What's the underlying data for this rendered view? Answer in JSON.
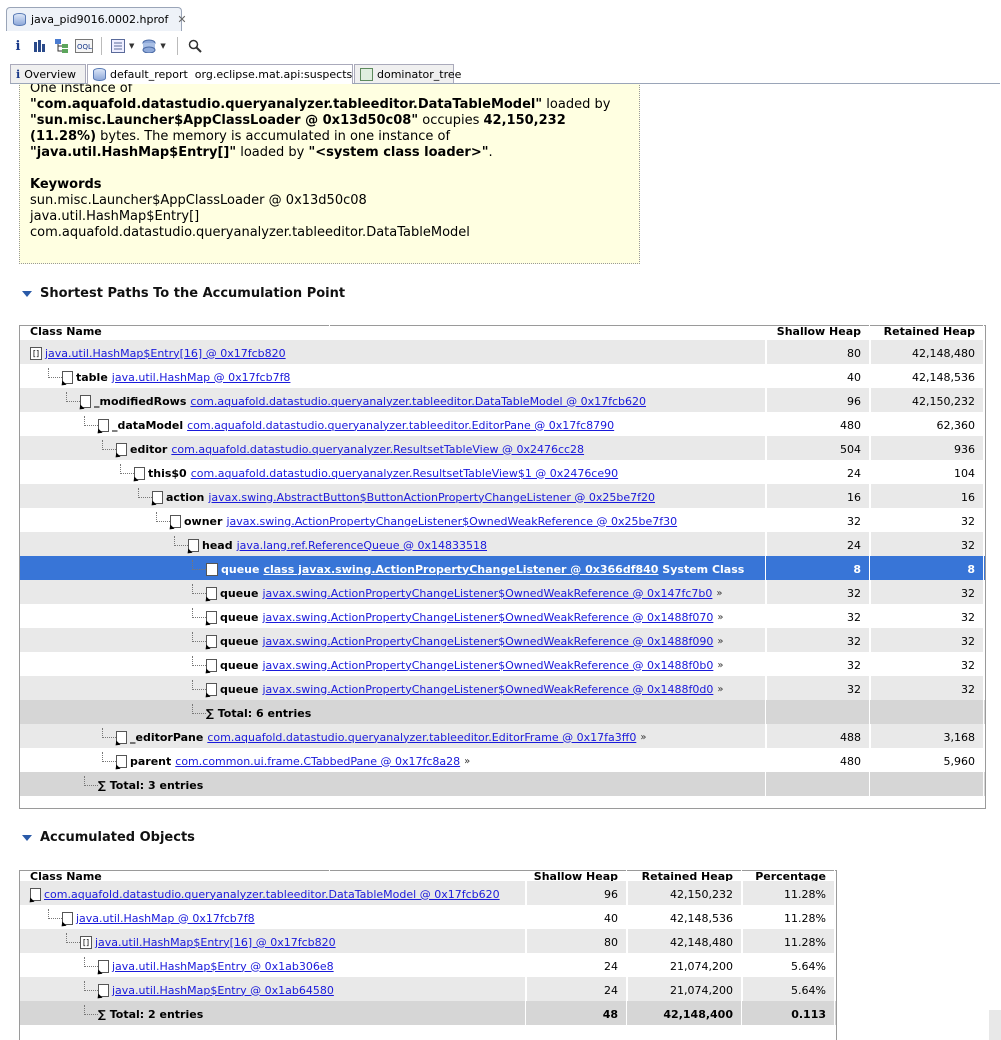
{
  "window": {
    "file_tab": "java_pid9016.0002.hprof",
    "toolbar_icons": [
      "info-icon",
      "histogram-icon",
      "dominator-tree-icon",
      "oql-icon",
      "query-browser-icon",
      "heap-dump-overview-icon",
      "search-icon"
    ]
  },
  "editor_tabs": [
    {
      "label": "Overview"
    },
    {
      "label": "default_report  org.eclipse.mat.api:suspects"
    },
    {
      "label": "dominator_tree"
    }
  ],
  "description": {
    "line1": "One instance of",
    "class_name": "\"com.aquafold.datastudio.queryanalyzer.tableeditor.DataTableModel\"",
    "loaded_by_1": " loaded by",
    "loader": "\"sun.misc.Launcher$AppClassLoader @ 0x13d50c08\"",
    "occupies": " occupies ",
    "bytes_value": "42,150,232",
    "percent": "(11.28%)",
    "accum_text": " bytes. The memory is accumulated in one instance of",
    "accum_class": "\"java.util.HashMap$Entry[]\"",
    "loaded_by_2": " loaded by ",
    "system_loader": "\"<system class loader>\"",
    "period": ".",
    "keywords_title": "Keywords",
    "keywords": [
      "sun.misc.Launcher$AppClassLoader @ 0x13d50c08",
      "java.util.HashMap$Entry[]",
      "com.aquafold.datastudio.queryanalyzer.tableeditor.DataTableModel"
    ]
  },
  "paths_section": {
    "title": "Shortest Paths To the Accumulation Point",
    "headers": {
      "class_name": "Class Name",
      "shallow": "Shallow Heap",
      "retained": "Retained Heap"
    },
    "rows": [
      {
        "field": "",
        "link": "java.util.HashMap$Entry[16] @ 0x17fcb820",
        "suffix": "",
        "shallow": "80",
        "retained": "42,148,480"
      },
      {
        "field": "table",
        "link": "java.util.HashMap @ 0x17fcb7f8",
        "suffix": "",
        "shallow": "40",
        "retained": "42,148,536"
      },
      {
        "field": "_modifiedRows",
        "link": "com.aquafold.datastudio.queryanalyzer.tableeditor.DataTableModel @ 0x17fcb620",
        "suffix": "",
        "shallow": "96",
        "retained": "42,150,232"
      },
      {
        "field": "_dataModel",
        "link": "com.aquafold.datastudio.queryanalyzer.tableeditor.EditorPane @ 0x17fc8790",
        "suffix": "",
        "shallow": "480",
        "retained": "62,360"
      },
      {
        "field": "editor",
        "link": "com.aquafold.datastudio.queryanalyzer.ResultsetTableView @ 0x2476cc28",
        "suffix": "",
        "shallow": "504",
        "retained": "936"
      },
      {
        "field": "this$0",
        "link": "com.aquafold.datastudio.queryanalyzer.ResultsetTableView$1 @ 0x2476ce90",
        "suffix": "",
        "shallow": "24",
        "retained": "104"
      },
      {
        "field": "action",
        "link": "javax.swing.AbstractButton$ButtonActionPropertyChangeListener @ 0x25be7f20",
        "suffix": "",
        "shallow": "16",
        "retained": "16"
      },
      {
        "field": "owner",
        "link": "javax.swing.ActionPropertyChangeListener$OwnedWeakReference @ 0x25be7f30",
        "suffix": "",
        "shallow": "32",
        "retained": "32"
      },
      {
        "field": "head",
        "link": "java.lang.ref.ReferenceQueue @ 0x14833518",
        "suffix": "",
        "shallow": "24",
        "retained": "32"
      },
      {
        "field": "queue",
        "link": "class javax.swing.ActionPropertyChangeListener @ 0x366df840",
        "suffix": " System Class",
        "shallow": "8",
        "retained": "8"
      },
      {
        "field": "queue",
        "link": "javax.swing.ActionPropertyChangeListener$OwnedWeakReference @ 0x147fc7b0",
        "suffix": "»",
        "shallow": "32",
        "retained": "32"
      },
      {
        "field": "queue",
        "link": "javax.swing.ActionPropertyChangeListener$OwnedWeakReference @ 0x1488f070",
        "suffix": "»",
        "shallow": "32",
        "retained": "32"
      },
      {
        "field": "queue",
        "link": "javax.swing.ActionPropertyChangeListener$OwnedWeakReference @ 0x1488f090",
        "suffix": "»",
        "shallow": "32",
        "retained": "32"
      },
      {
        "field": "queue",
        "link": "javax.swing.ActionPropertyChangeListener$OwnedWeakReference @ 0x1488f0b0",
        "suffix": "»",
        "shallow": "32",
        "retained": "32"
      },
      {
        "field": "queue",
        "link": "javax.swing.ActionPropertyChangeListener$OwnedWeakReference @ 0x1488f0d0",
        "suffix": "»",
        "shallow": "32",
        "retained": "32"
      },
      {
        "field": "",
        "link": "",
        "total": "∑ Total: 6 entries",
        "shallow": "",
        "retained": ""
      },
      {
        "field": "_editorPane",
        "link": "com.aquafold.datastudio.queryanalyzer.tableeditor.EditorFrame @ 0x17fa3ff0",
        "suffix": "»",
        "shallow": "488",
        "retained": "3,168"
      },
      {
        "field": "parent",
        "link": "com.common.ui.frame.CTabbedPane @ 0x17fc8a28",
        "suffix": "»",
        "shallow": "480",
        "retained": "5,960"
      },
      {
        "field": "",
        "link": "",
        "total": "∑ Total: 3 entries",
        "shallow": "",
        "retained": ""
      }
    ]
  },
  "accum_section": {
    "title": "Accumulated Objects",
    "headers": {
      "class_name": "Class Name",
      "shallow": "Shallow Heap",
      "retained": "Retained Heap",
      "percentage": "Percentage"
    },
    "rows": [
      {
        "link": "com.aquafold.datastudio.queryanalyzer.tableeditor.DataTableModel @ 0x17fcb620",
        "shallow": "96",
        "retained": "42,150,232",
        "percentage": "11.28%"
      },
      {
        "link": "java.util.HashMap @ 0x17fcb7f8",
        "shallow": "40",
        "retained": "42,148,536",
        "percentage": "11.28%"
      },
      {
        "link": "java.util.HashMap$Entry[16] @ 0x17fcb820",
        "shallow": "80",
        "retained": "42,148,480",
        "percentage": "11.28%"
      },
      {
        "link": "java.util.HashMap$Entry @ 0x1ab306e8",
        "shallow": "24",
        "retained": "21,074,200",
        "percentage": "5.64%"
      },
      {
        "link": "java.util.HashMap$Entry @ 0x1ab64580",
        "shallow": "24",
        "retained": "21,074,200",
        "percentage": "5.64%"
      },
      {
        "link": "",
        "total": "∑ Total: 2 entries",
        "shallow": "48",
        "retained": "42,148,400",
        "percentage": "0.113"
      }
    ]
  }
}
